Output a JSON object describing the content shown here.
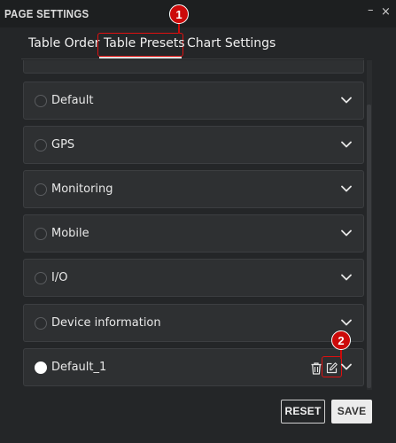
{
  "window": {
    "title": "PAGE SETTINGS",
    "minimize_symbol": "–",
    "close_symbol": "×"
  },
  "tabs": [
    {
      "label": "Table Order",
      "active": false
    },
    {
      "label": "Table Presets",
      "active": true
    },
    {
      "label": "Chart Settings",
      "active": false
    }
  ],
  "markers": {
    "tab": "1",
    "edit": "2"
  },
  "presets": [
    {
      "label": "Default",
      "selected": false
    },
    {
      "label": "GPS",
      "selected": false
    },
    {
      "label": "Monitoring",
      "selected": false
    },
    {
      "label": "Mobile",
      "selected": false
    },
    {
      "label": "I/O",
      "selected": false
    },
    {
      "label": "Device information",
      "selected": false
    },
    {
      "label": "Default_1",
      "selected": true,
      "custom": true
    }
  ],
  "icons": {
    "expand": "chevron-down-icon",
    "delete": "trash-icon",
    "edit": "edit-icon"
  },
  "footer": {
    "reset_label": "RESET",
    "save_label": "SAVE"
  },
  "colors": {
    "background": "#242628",
    "panel": "#2e3032",
    "highlight": "#e01010",
    "marker": "#cc0a0a"
  }
}
